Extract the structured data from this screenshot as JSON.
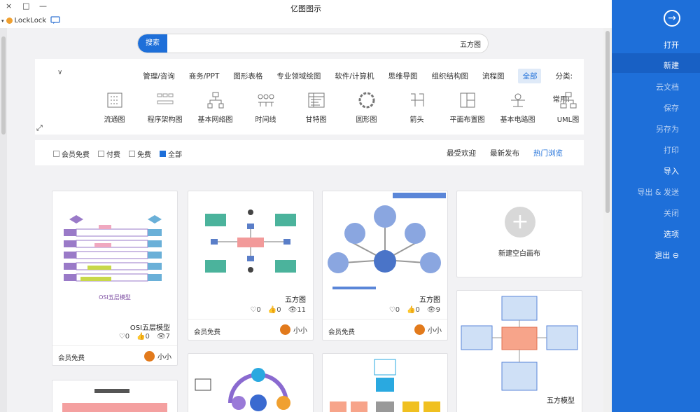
{
  "window": {
    "title": "亿图图示",
    "controls": [
      "×",
      "□",
      "—"
    ]
  },
  "locklock": {
    "label": "LockLock",
    "chat_icon": "chat-icon"
  },
  "search": {
    "button": "搜索",
    "value": "五方图"
  },
  "categories": {
    "label": "分类:",
    "items": [
      "全部",
      "流程图",
      "组织结构图",
      "思维导图",
      "软件/计算机",
      "专业领域绘图",
      "图形表格",
      "商务/PPT",
      "管理/咨询"
    ],
    "active_index": 0
  },
  "common": {
    "label": "常用:",
    "types": [
      "UML图",
      "基本电路图",
      "平面布置图",
      "箭头",
      "圆形图",
      "甘特图",
      "时间线",
      "基本网络图",
      "程序架构图",
      "流通图"
    ]
  },
  "sort": {
    "items": [
      "热门浏览",
      "最新发布",
      "最受欢迎"
    ],
    "active_index": 0
  },
  "filters": {
    "items": [
      "全部",
      "免费",
      "付费",
      "会员免费"
    ],
    "checked_index": 0
  },
  "new_canvas": {
    "label": "新建空白画布"
  },
  "cards": [
    {
      "title": "五方图",
      "views": "9",
      "likes": "0",
      "comments": "0",
      "author": "小小",
      "tag": "会员免费"
    },
    {
      "title": "五方图",
      "views": "11",
      "likes": "0",
      "comments": "0",
      "author": "小小",
      "tag": "会员免费"
    },
    {
      "title": "OSI五层模型",
      "caption": "OSI五层模型",
      "views": "7",
      "likes": "0",
      "comments": "0",
      "author": "小小",
      "tag": "会员免费"
    },
    {
      "title": "五方模型"
    }
  ],
  "sidebar": {
    "items": [
      "打开",
      "新建",
      "云文档",
      "保存",
      "另存为",
      "打印",
      "导入",
      "导出 & 发送",
      "关闭",
      "选项",
      "退出"
    ],
    "selected_index": 1
  },
  "colors": {
    "accent": "#1e6fd9",
    "sidebar": "#1e6fd9"
  }
}
